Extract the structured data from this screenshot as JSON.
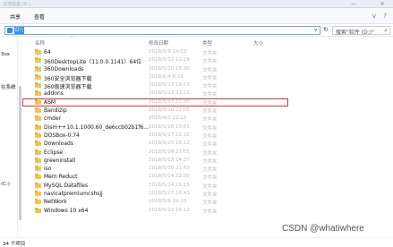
{
  "window": {
    "title": "本地磁盘 (D:)",
    "minimize_glyph": "—",
    "close_glyph": "✕"
  },
  "ribbon": {
    "tabs": [
      "共享",
      "查看"
    ],
    "help_glyph": "?",
    "expand_glyph": "v"
  },
  "address": {
    "path": "D:\\",
    "dropdown_glyph": "v",
    "refresh_glyph": "↻",
    "search_placeholder": "搜索\"软件 (D:)\"",
    "search_icon": "search-icon"
  },
  "nav": {
    "items": [
      {
        "label": "3ox"
      },
      {
        "label": "在系统"
      },
      {
        "label": "(C:)"
      }
    ]
  },
  "columns": {
    "name": "名称",
    "date": "修改日期",
    "type": "类型",
    "size": "大小",
    "sort_glyph": "^"
  },
  "files": [
    {
      "name": "64",
      "date": "2018/5/9 14:03",
      "type": "文件夹"
    },
    {
      "name": "360DesktopLite（11.0.0.1141）64位",
      "date": "2018/5/12 11:19",
      "type": "文件夹"
    },
    {
      "name": "360Downloads",
      "date": "2018/5/20 15:30",
      "type": "文件夹"
    },
    {
      "name": "360安全浏览器下载",
      "date": "2018/6/4 8:14",
      "type": "文件夹"
    },
    {
      "name": "360极速浏览器下载",
      "date": "2018/5/17 19:53",
      "type": "文件夹"
    },
    {
      "name": "addons",
      "date": "2018/5/22 21:21",
      "type": "文件夹"
    },
    {
      "name": "ASM",
      "date": "2018/5/17 22:30",
      "type": "文件夹"
    },
    {
      "name": "Bandizip",
      "date": "2018/5/10 22:05",
      "type": "文件夹"
    },
    {
      "name": "cmder",
      "date": "2018/4/3 22:12",
      "type": "文件夹"
    },
    {
      "name": "Dism++10.1.1000.60_de6ccb02b1f6...",
      "date": "2018/5/16 15:01",
      "type": "文件夹"
    },
    {
      "name": "DOSBox-0.74",
      "date": "2018/5/17 22:32",
      "type": "文件夹"
    },
    {
      "name": "Downloads",
      "date": "2018/5/25 16:12",
      "type": "文件夹"
    },
    {
      "name": "Eclipse",
      "date": "2018/5/29 21:05",
      "type": "文件夹"
    },
    {
      "name": "greeninstall",
      "date": "2018/5/13 14:37",
      "type": "文件夹"
    },
    {
      "name": "iso",
      "date": "2018/5/30 21:43",
      "type": "文件夹"
    },
    {
      "name": "Mem Reduct",
      "date": "2018/5/14 22:30",
      "type": "文件夹"
    },
    {
      "name": "MySQL Datafiles",
      "date": "2018/5/24 21:15",
      "type": "文件夹"
    },
    {
      "name": "navicatpremiumcshsjj",
      "date": "2018/5/27 16:43",
      "type": "文件夹"
    },
    {
      "name": "NetWork",
      "date": "2018/5/9 19:20",
      "type": "文件夹"
    },
    {
      "name": "Windows 10 x64",
      "date": "2018/5/13 19:12",
      "type": "文件夹"
    }
  ],
  "highlight_index": 6,
  "status": {
    "text": "34 个项目"
  },
  "watermark": "CSDN @whatiwhere"
}
